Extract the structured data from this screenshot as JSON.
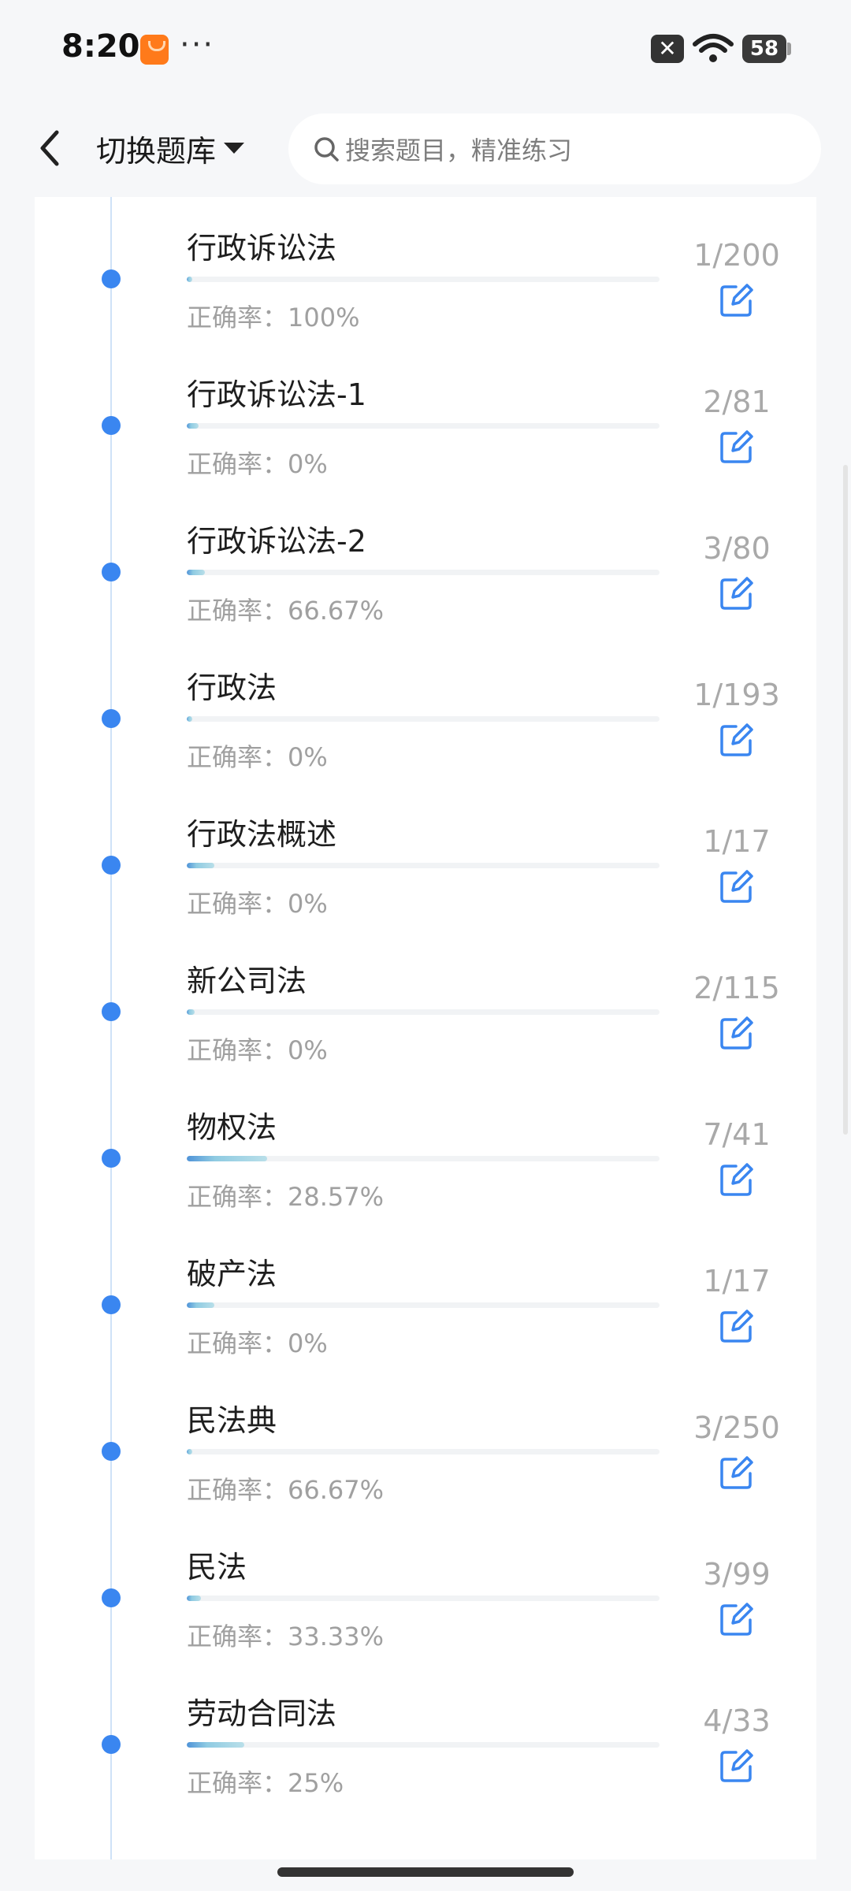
{
  "status_bar": {
    "time": "8:20",
    "more": "···",
    "battery": "58",
    "icons": [
      "shopping-app-icon",
      "close-notification-icon",
      "wifi-icon",
      "battery-icon"
    ]
  },
  "header": {
    "switch_label": "切换题库",
    "search_placeholder": "搜索题目，精准练习"
  },
  "colors": {
    "accent": "#3a86f0",
    "progress_start": "#4f93d8",
    "progress_end": "#b9dfe9",
    "muted": "#a0a0a0"
  },
  "items": [
    {
      "title": "行政诉讼法",
      "count": "1/200",
      "accuracy": "正确率：100%",
      "progress": 0.005
    },
    {
      "title": "行政诉讼法-1",
      "count": "2/81",
      "accuracy": "正确率：0%",
      "progress": 0.0247
    },
    {
      "title": "行政诉讼法-2",
      "count": "3/80",
      "accuracy": "正确率：66.67%",
      "progress": 0.0375
    },
    {
      "title": "行政法",
      "count": "1/193",
      "accuracy": "正确率：0%",
      "progress": 0.0052
    },
    {
      "title": "行政法概述",
      "count": "1/17",
      "accuracy": "正确率：0%",
      "progress": 0.0588
    },
    {
      "title": "新公司法",
      "count": "2/115",
      "accuracy": "正确率：0%",
      "progress": 0.0174
    },
    {
      "title": "物权法",
      "count": "7/41",
      "accuracy": "正确率：28.57%",
      "progress": 0.1707
    },
    {
      "title": "破产法",
      "count": "1/17",
      "accuracy": "正确率：0%",
      "progress": 0.0588
    },
    {
      "title": "民法典",
      "count": "3/250",
      "accuracy": "正确率：66.67%",
      "progress": 0.012
    },
    {
      "title": "民法",
      "count": "3/99",
      "accuracy": "正确率：33.33%",
      "progress": 0.0303
    },
    {
      "title": "劳动合同法",
      "count": "4/33",
      "accuracy": "正确率：25%",
      "progress": 0.1212
    }
  ]
}
